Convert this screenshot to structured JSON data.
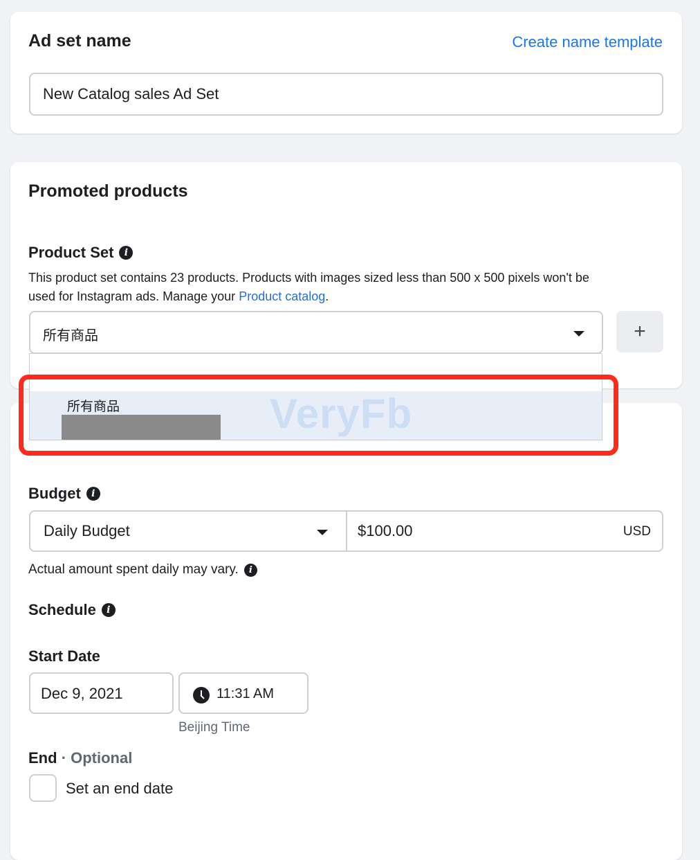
{
  "ad_set": {
    "heading": "Ad set name",
    "create_template_link": "Create name template",
    "name_value": "New Catalog sales Ad Set"
  },
  "promoted": {
    "heading": "Promoted products",
    "product_set_label": "Product Set",
    "description_line1": "This product set contains 23 products. Products with images sized less than 500 x 500 pixels won't be",
    "description_line2_prefix": "used for Instagram ads. Manage your",
    "description_link": "Product catalog",
    "description_suffix": ".",
    "selected_value": "所有商品",
    "plus_symbol": "+",
    "menu_option": "所有商品",
    "watermark": "VeryFb"
  },
  "budget": {
    "label": "Budget",
    "type_value": "Daily Budget",
    "amount_value": "$100.00",
    "currency": "USD",
    "note": "Actual amount spent daily may vary."
  },
  "schedule": {
    "label": "Schedule",
    "start_date_label": "Start Date",
    "date_value": "Dec 9, 2021",
    "time_value": "11:31 AM",
    "timezone": "Beijing Time",
    "end_label": "End",
    "end_optional": "· Optional",
    "end_checkbox_label": "Set an end date"
  },
  "colors": {
    "accent": "#1877f2",
    "highlight": "#ff2a1a",
    "background": "#f0f2f5"
  }
}
